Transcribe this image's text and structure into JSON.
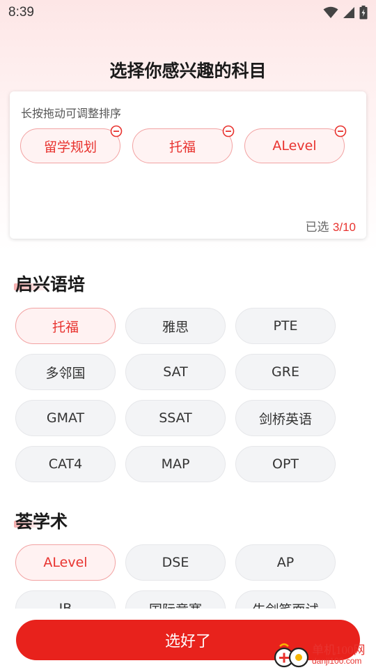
{
  "status_bar": {
    "time": "8:39"
  },
  "title": "选择你感兴趣的科目",
  "selected": {
    "hint": "长按拖动可调整排序",
    "chips": [
      "留学规划",
      "托福",
      "ALevel"
    ],
    "count_label": "已选",
    "count": "3/10"
  },
  "sections": [
    {
      "title": "启兴语培",
      "chips": [
        {
          "label": "托福",
          "selected": true
        },
        {
          "label": "雅思",
          "selected": false
        },
        {
          "label": "PTE",
          "selected": false
        },
        {
          "label": "多邻国",
          "selected": false
        },
        {
          "label": "SAT",
          "selected": false
        },
        {
          "label": "GRE",
          "selected": false
        },
        {
          "label": "GMAT",
          "selected": false
        },
        {
          "label": "SSAT",
          "selected": false
        },
        {
          "label": "剑桥英语",
          "selected": false
        },
        {
          "label": "CAT4",
          "selected": false
        },
        {
          "label": "MAP",
          "selected": false
        },
        {
          "label": "OPT",
          "selected": false
        }
      ]
    },
    {
      "title": "荟学术",
      "chips": [
        {
          "label": "ALevel",
          "selected": true
        },
        {
          "label": "DSE",
          "selected": false
        },
        {
          "label": "AP",
          "selected": false
        },
        {
          "label": "IB",
          "selected": false
        },
        {
          "label": "国际竞赛",
          "selected": false
        },
        {
          "label": "牛剑笔面试",
          "selected": false
        }
      ]
    }
  ],
  "confirm_button": "选好了",
  "watermark": {
    "line1": "单机100网",
    "line2": "danji100.com"
  },
  "colors": {
    "accent": "#e8332f",
    "button": "#e8221c",
    "chip_bg": "#f3f4f6"
  },
  "icons": [
    "wifi-icon",
    "signal-icon",
    "battery-icon",
    "remove-icon"
  ]
}
